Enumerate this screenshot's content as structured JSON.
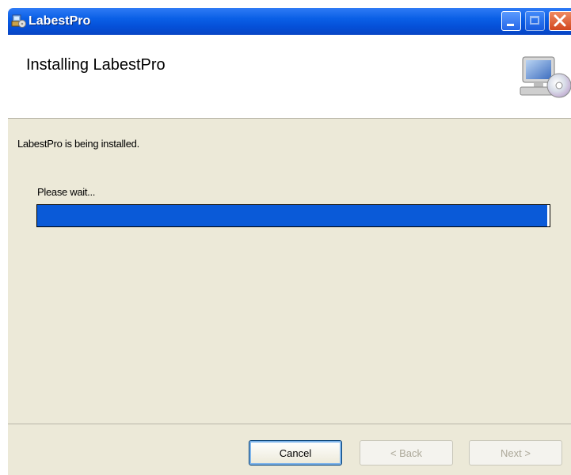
{
  "window": {
    "title": "LabestPro",
    "titlebar_color": "#0550d8"
  },
  "header": {
    "title": "Installing LabestPro",
    "icon": "computer-with-cd-icon"
  },
  "content": {
    "status": "LabestPro is being installed.",
    "wait_label": "Please wait...",
    "progress_percent": 99.5,
    "progress_color": "#0a5ad8"
  },
  "footer": {
    "cancel_label": "Cancel",
    "back_label": "< Back",
    "next_label": "Next >"
  }
}
